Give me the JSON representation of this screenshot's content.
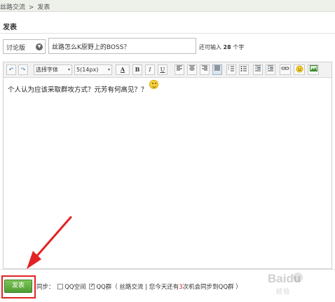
{
  "breadcrumb": {
    "parent": "丝路交流",
    "separator": ">",
    "current": "发表"
  },
  "section": {
    "title": "发表"
  },
  "form": {
    "forum_select": "讨论版",
    "title_value": "丝路怎么K原野上的BOSS？",
    "remain_prefix": "还可输入",
    "remain_count": "28",
    "remain_suffix": "个字"
  },
  "toolbar": {
    "undo_icon": "↶",
    "redo_icon": "↷",
    "font_label": "选择字体",
    "size_label": "5(14px)",
    "font_color_label": "A",
    "bold_label": "B",
    "italic_label": "I",
    "underline_label": "U",
    "dropdown_glyph": "▾"
  },
  "editor": {
    "content": "个人认为应该采取群攻方式？元芳有何高见？？"
  },
  "footer": {
    "post_label": "发表",
    "sync_label": "同步：",
    "qzone_label": "QQ空间",
    "qqgroup_label": "QQ群（",
    "group_name": "丝路交流",
    "divider": "|",
    "today_prefix": "您今天还有",
    "today_count": "3",
    "today_suffix": "次机会同步到QQ群",
    "close_paren": "）"
  },
  "watermark": {
    "brand": "Baidu",
    "sub": "经验"
  },
  "colors": {
    "post_button": "#5aa83c",
    "highlight": "#e32323",
    "count_red": "#d92323"
  }
}
